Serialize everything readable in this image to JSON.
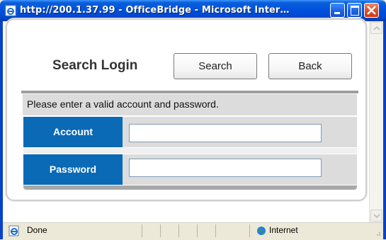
{
  "window": {
    "title": "http://200.1.37.99 - OfficeBridge - Microsoft Inter…",
    "minimize_icon": "minimize-icon",
    "maximize_icon": "maximize-icon",
    "close_icon": "close-icon"
  },
  "page": {
    "heading": "Search Login",
    "search_label": "Search",
    "back_label": "Back",
    "message": "Please enter a valid account and password.",
    "account_label": "Account",
    "account_value": "",
    "password_label": "Password",
    "password_value": ""
  },
  "status": {
    "text": "Done",
    "zone": "Internet"
  },
  "colors": {
    "titlebar": "#0050e0",
    "label_bg": "#0a6ab6"
  }
}
